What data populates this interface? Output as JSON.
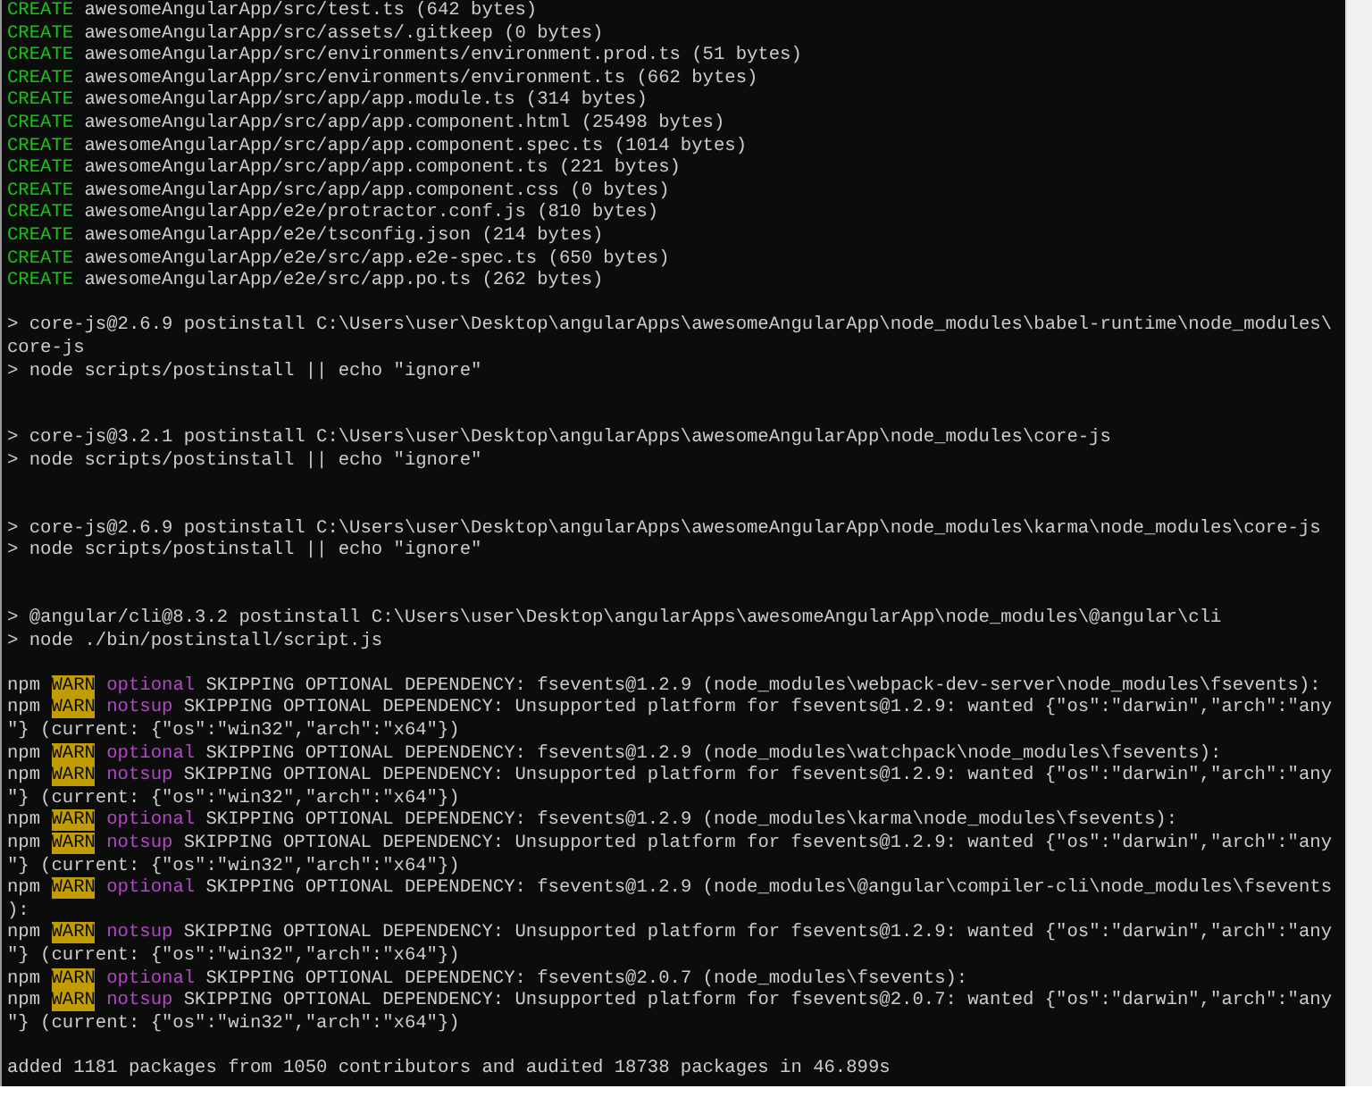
{
  "sections": [
    {
      "spaced": false,
      "double_spaced": false,
      "lines": [
        [
          {
            "kind": "create",
            "text": "CREATE"
          },
          {
            "kind": "plain",
            "text": " awesomeAngularApp/src/test.ts (642 bytes)"
          }
        ],
        [
          {
            "kind": "create",
            "text": "CREATE"
          },
          {
            "kind": "plain",
            "text": " awesomeAngularApp/src/assets/.gitkeep (0 bytes)"
          }
        ],
        [
          {
            "kind": "create",
            "text": "CREATE"
          },
          {
            "kind": "plain",
            "text": " awesomeAngularApp/src/environments/environment.prod.ts (51 bytes)"
          }
        ],
        [
          {
            "kind": "create",
            "text": "CREATE"
          },
          {
            "kind": "plain",
            "text": " awesomeAngularApp/src/environments/environment.ts (662 bytes)"
          }
        ],
        [
          {
            "kind": "create",
            "text": "CREATE"
          },
          {
            "kind": "plain",
            "text": " awesomeAngularApp/src/app/app.module.ts (314 bytes)"
          }
        ],
        [
          {
            "kind": "create",
            "text": "CREATE"
          },
          {
            "kind": "plain",
            "text": " awesomeAngularApp/src/app/app.component.html (25498 bytes)"
          }
        ],
        [
          {
            "kind": "create",
            "text": "CREATE"
          },
          {
            "kind": "plain",
            "text": " awesomeAngularApp/src/app/app.component.spec.ts (1014 bytes)"
          }
        ],
        [
          {
            "kind": "create",
            "text": "CREATE"
          },
          {
            "kind": "plain",
            "text": " awesomeAngularApp/src/app/app.component.ts (221 bytes)"
          }
        ],
        [
          {
            "kind": "create",
            "text": "CREATE"
          },
          {
            "kind": "plain",
            "text": " awesomeAngularApp/src/app/app.component.css (0 bytes)"
          }
        ],
        [
          {
            "kind": "create",
            "text": "CREATE"
          },
          {
            "kind": "plain",
            "text": " awesomeAngularApp/e2e/protractor.conf.js (810 bytes)"
          }
        ],
        [
          {
            "kind": "create",
            "text": "CREATE"
          },
          {
            "kind": "plain",
            "text": " awesomeAngularApp/e2e/tsconfig.json (214 bytes)"
          }
        ],
        [
          {
            "kind": "create",
            "text": "CREATE"
          },
          {
            "kind": "plain",
            "text": " awesomeAngularApp/e2e/src/app.e2e-spec.ts (650 bytes)"
          }
        ],
        [
          {
            "kind": "create",
            "text": "CREATE"
          },
          {
            "kind": "plain",
            "text": " awesomeAngularApp/e2e/src/app.po.ts (262 bytes)"
          }
        ]
      ]
    },
    {
      "spaced": true,
      "double_spaced": false,
      "lines": [
        [
          {
            "kind": "plain",
            "text": "> core-js@2.6.9 postinstall C:\\Users\\user\\Desktop\\angularApps\\awesomeAngularApp\\node_modules\\babel-runtime\\node_modules\\"
          }
        ],
        [
          {
            "kind": "plain",
            "text": "core-js"
          }
        ],
        [
          {
            "kind": "plain",
            "text": "> node scripts/postinstall || echo \"ignore\""
          }
        ]
      ]
    },
    {
      "spaced": true,
      "double_spaced": true,
      "lines": [
        [
          {
            "kind": "plain",
            "text": "> core-js@3.2.1 postinstall C:\\Users\\user\\Desktop\\angularApps\\awesomeAngularApp\\node_modules\\core-js"
          }
        ],
        [
          {
            "kind": "plain",
            "text": "> node scripts/postinstall || echo \"ignore\""
          }
        ]
      ]
    },
    {
      "spaced": true,
      "double_spaced": true,
      "lines": [
        [
          {
            "kind": "plain",
            "text": "> core-js@2.6.9 postinstall C:\\Users\\user\\Desktop\\angularApps\\awesomeAngularApp\\node_modules\\karma\\node_modules\\core-js"
          }
        ],
        [
          {
            "kind": "plain",
            "text": "> node scripts/postinstall || echo \"ignore\""
          }
        ]
      ]
    },
    {
      "spaced": true,
      "double_spaced": true,
      "lines": [
        [
          {
            "kind": "plain",
            "text": "> @angular/cli@8.3.2 postinstall C:\\Users\\user\\Desktop\\angularApps\\awesomeAngularApp\\node_modules\\@angular\\cli"
          }
        ],
        [
          {
            "kind": "plain",
            "text": "> node ./bin/postinstall/script.js"
          }
        ]
      ]
    },
    {
      "spaced": true,
      "double_spaced": false,
      "lines": [
        [
          {
            "kind": "plain",
            "text": "npm "
          },
          {
            "kind": "warn",
            "text": "WARN"
          },
          {
            "kind": "level",
            "text": " optional"
          },
          {
            "kind": "plain",
            "text": " SKIPPING OPTIONAL DEPENDENCY: fsevents@1.2.9 (node_modules\\webpack-dev-server\\node_modules\\fsevents):"
          }
        ],
        [
          {
            "kind": "plain",
            "text": "npm "
          },
          {
            "kind": "warn",
            "text": "WARN"
          },
          {
            "kind": "level",
            "text": " notsup"
          },
          {
            "kind": "plain",
            "text": " SKIPPING OPTIONAL DEPENDENCY: Unsupported platform for fsevents@1.2.9: wanted {\"os\":\"darwin\",\"arch\":\"any"
          }
        ],
        [
          {
            "kind": "plain",
            "text": "\"} (current: {\"os\":\"win32\",\"arch\":\"x64\"})"
          }
        ],
        [
          {
            "kind": "plain",
            "text": "npm "
          },
          {
            "kind": "warn",
            "text": "WARN"
          },
          {
            "kind": "level",
            "text": " optional"
          },
          {
            "kind": "plain",
            "text": " SKIPPING OPTIONAL DEPENDENCY: fsevents@1.2.9 (node_modules\\watchpack\\node_modules\\fsevents):"
          }
        ],
        [
          {
            "kind": "plain",
            "text": "npm "
          },
          {
            "kind": "warn",
            "text": "WARN"
          },
          {
            "kind": "level",
            "text": " notsup"
          },
          {
            "kind": "plain",
            "text": " SKIPPING OPTIONAL DEPENDENCY: Unsupported platform for fsevents@1.2.9: wanted {\"os\":\"darwin\",\"arch\":\"any"
          }
        ],
        [
          {
            "kind": "plain",
            "text": "\"} (current: {\"os\":\"win32\",\"arch\":\"x64\"})"
          }
        ],
        [
          {
            "kind": "plain",
            "text": "npm "
          },
          {
            "kind": "warn",
            "text": "WARN"
          },
          {
            "kind": "level",
            "text": " optional"
          },
          {
            "kind": "plain",
            "text": " SKIPPING OPTIONAL DEPENDENCY: fsevents@1.2.9 (node_modules\\karma\\node_modules\\fsevents):"
          }
        ],
        [
          {
            "kind": "plain",
            "text": "npm "
          },
          {
            "kind": "warn",
            "text": "WARN"
          },
          {
            "kind": "level",
            "text": " notsup"
          },
          {
            "kind": "plain",
            "text": " SKIPPING OPTIONAL DEPENDENCY: Unsupported platform for fsevents@1.2.9: wanted {\"os\":\"darwin\",\"arch\":\"any"
          }
        ],
        [
          {
            "kind": "plain",
            "text": "\"} (current: {\"os\":\"win32\",\"arch\":\"x64\"})"
          }
        ],
        [
          {
            "kind": "plain",
            "text": "npm "
          },
          {
            "kind": "warn",
            "text": "WARN"
          },
          {
            "kind": "level",
            "text": " optional"
          },
          {
            "kind": "plain",
            "text": " SKIPPING OPTIONAL DEPENDENCY: fsevents@1.2.9 (node_modules\\@angular\\compiler-cli\\node_modules\\fsevents"
          }
        ],
        [
          {
            "kind": "plain",
            "text": "):"
          }
        ],
        [
          {
            "kind": "plain",
            "text": "npm "
          },
          {
            "kind": "warn",
            "text": "WARN"
          },
          {
            "kind": "level",
            "text": " notsup"
          },
          {
            "kind": "plain",
            "text": " SKIPPING OPTIONAL DEPENDENCY: Unsupported platform for fsevents@1.2.9: wanted {\"os\":\"darwin\",\"arch\":\"any"
          }
        ],
        [
          {
            "kind": "plain",
            "text": "\"} (current: {\"os\":\"win32\",\"arch\":\"x64\"})"
          }
        ],
        [
          {
            "kind": "plain",
            "text": "npm "
          },
          {
            "kind": "warn",
            "text": "WARN"
          },
          {
            "kind": "level",
            "text": " optional"
          },
          {
            "kind": "plain",
            "text": " SKIPPING OPTIONAL DEPENDENCY: fsevents@2.0.7 (node_modules\\fsevents):"
          }
        ],
        [
          {
            "kind": "plain",
            "text": "npm "
          },
          {
            "kind": "warn",
            "text": "WARN"
          },
          {
            "kind": "level",
            "text": " notsup"
          },
          {
            "kind": "plain",
            "text": " SKIPPING OPTIONAL DEPENDENCY: Unsupported platform for fsevents@2.0.7: wanted {\"os\":\"darwin\",\"arch\":\"any"
          }
        ],
        [
          {
            "kind": "plain",
            "text": "\"} (current: {\"os\":\"win32\",\"arch\":\"x64\"})"
          }
        ]
      ]
    },
    {
      "spaced": true,
      "double_spaced": false,
      "lines": [
        [
          {
            "kind": "plain",
            "text": "added 1181 packages from 1050 contributors and audited 18738 packages in 46.899s"
          }
        ]
      ]
    }
  ]
}
